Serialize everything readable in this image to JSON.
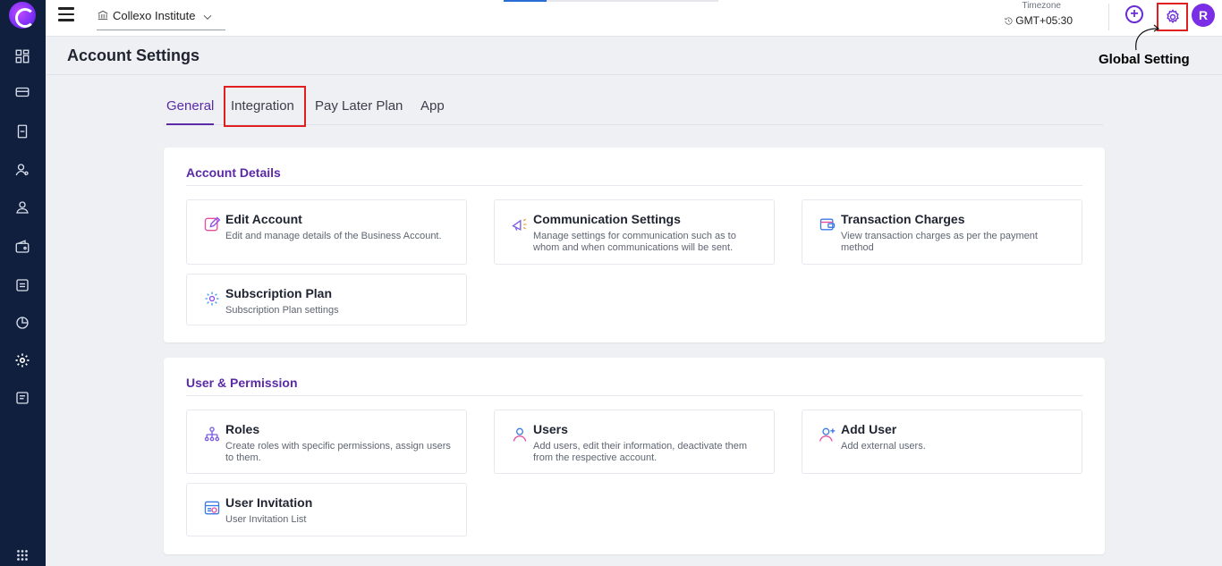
{
  "topbar": {
    "institute": "Collexo Institute",
    "timezone_label": "Timezone",
    "timezone_value": "GMT+05:30",
    "avatar_initial": "R"
  },
  "annotation": {
    "label": "Global Setting"
  },
  "page": {
    "title": "Account Settings"
  },
  "tabs": [
    {
      "label": "General"
    },
    {
      "label": "Integration"
    },
    {
      "label": "Pay Later Plan"
    },
    {
      "label": "App"
    }
  ],
  "sections": [
    {
      "title": "Account Details",
      "tiles": [
        {
          "title": "Edit Account",
          "desc": "Edit and manage details of the Business Account.",
          "icon": "edit-icon"
        },
        {
          "title": "Communication Settings",
          "desc": "Manage settings for communication such as to whom and when communications will be sent.",
          "icon": "megaphone-icon"
        },
        {
          "title": "Transaction Charges",
          "desc": "View transaction charges as per the payment method",
          "icon": "wallet-icon"
        },
        {
          "title": "Subscription Plan",
          "desc": "Subscription Plan settings",
          "icon": "settings-gear-icon"
        }
      ]
    },
    {
      "title": "User & Permission",
      "tiles": [
        {
          "title": "Roles",
          "desc": "Create roles with specific permissions, assign users to them.",
          "icon": "hierarchy-icon"
        },
        {
          "title": "Users",
          "desc": "Add users, edit their information, deactivate them from the respective account.",
          "icon": "user-icon"
        },
        {
          "title": "Add User",
          "desc": "Add external users.",
          "icon": "add-user-icon"
        },
        {
          "title": "User Invitation",
          "desc": "User Invitation List",
          "icon": "invitation-icon"
        }
      ]
    }
  ],
  "colors": {
    "accent": "#5b2aa9",
    "sidebar": "#0f1f3d",
    "highlight": "#e02020"
  }
}
